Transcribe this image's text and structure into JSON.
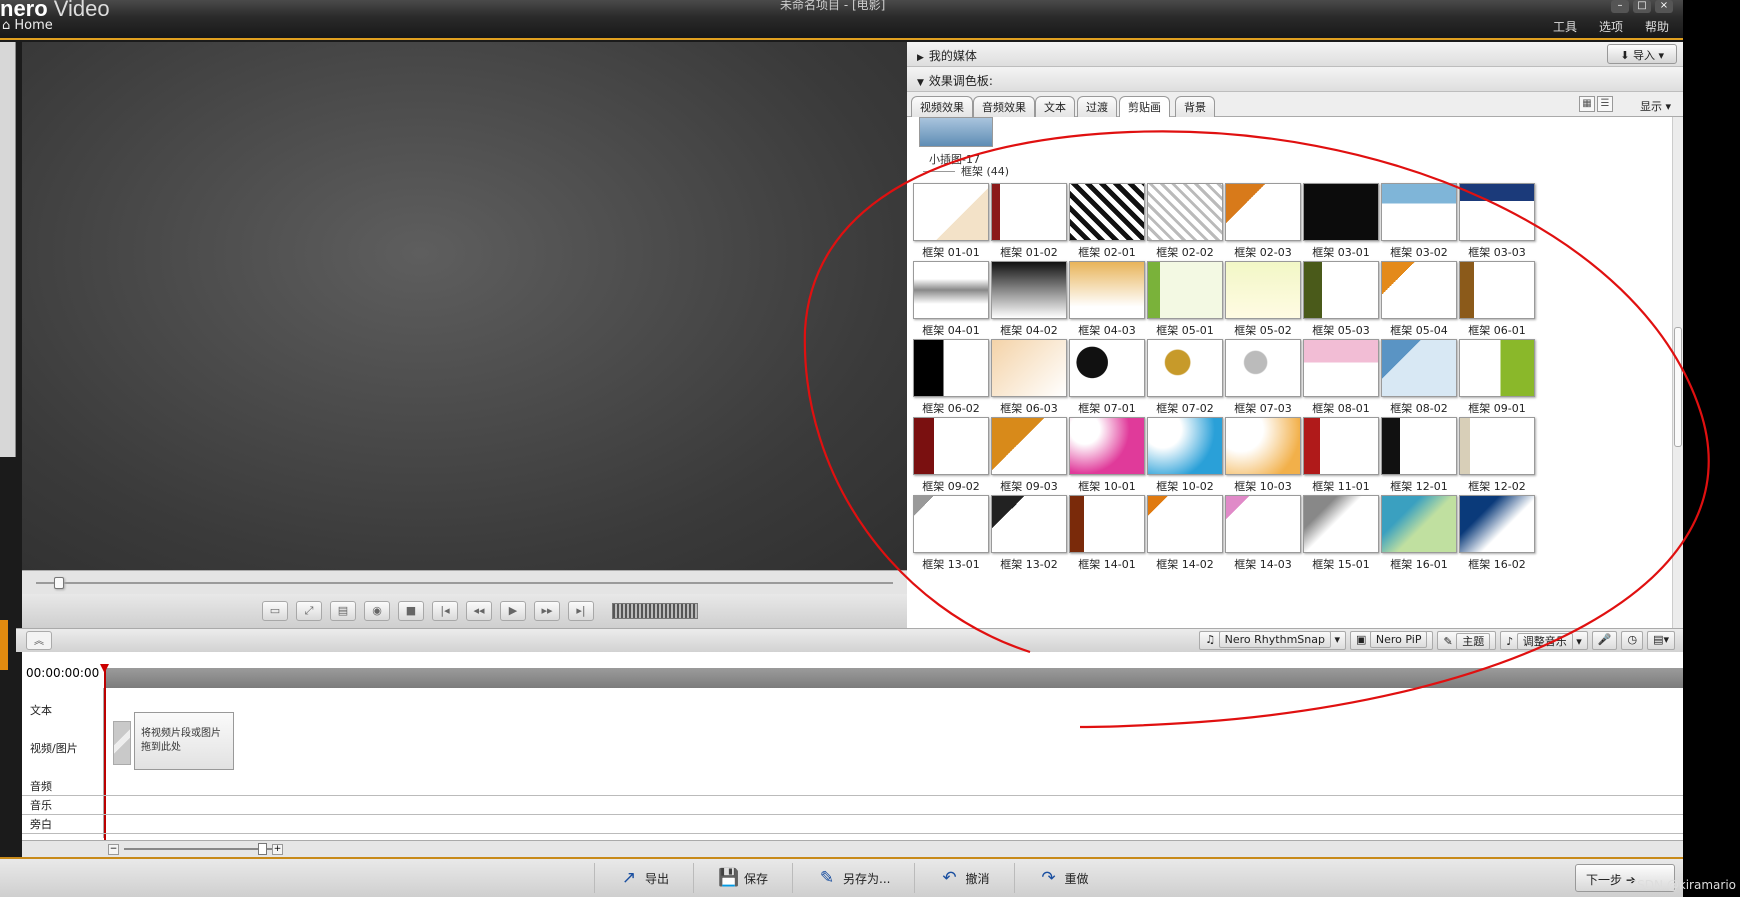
{
  "app": {
    "logo": "nero",
    "logo_suffix": "Video",
    "home": "Home",
    "window_title": "未命名项目 - [电影]",
    "menus": [
      "工具",
      "选项",
      "帮助"
    ]
  },
  "panels": {
    "my_media": "我的媒体",
    "import": "导入",
    "effects_palette": "效果调色板:",
    "show": "显示"
  },
  "tabs": [
    "视频效果",
    "音频效果",
    "文本",
    "过渡",
    "剪贴画",
    "背景"
  ],
  "active_tab": 4,
  "prev_group_item": "小插图-17",
  "group": {
    "label": "框架 (44)"
  },
  "tiles": [
    {
      "label": "框架 01-01"
    },
    {
      "label": "框架 01-02"
    },
    {
      "label": "框架 02-01"
    },
    {
      "label": "框架 02-02"
    },
    {
      "label": "框架 02-03"
    },
    {
      "label": "框架 03-01"
    },
    {
      "label": "框架 03-02"
    },
    {
      "label": "框架 03-03"
    },
    {
      "label": "框架 04-01"
    },
    {
      "label": "框架 04-02"
    },
    {
      "label": "框架 04-03"
    },
    {
      "label": "框架 05-01"
    },
    {
      "label": "框架 05-02"
    },
    {
      "label": "框架 05-03"
    },
    {
      "label": "框架 05-04"
    },
    {
      "label": "框架 06-01"
    },
    {
      "label": "框架 06-02"
    },
    {
      "label": "框架 06-03"
    },
    {
      "label": "框架 07-01"
    },
    {
      "label": "框架 07-02"
    },
    {
      "label": "框架 07-03"
    },
    {
      "label": "框架 08-01"
    },
    {
      "label": "框架 08-02"
    },
    {
      "label": "框架 09-01"
    },
    {
      "label": "框架 09-02"
    },
    {
      "label": "框架 09-03"
    },
    {
      "label": "框架 10-01"
    },
    {
      "label": "框架 10-02"
    },
    {
      "label": "框架 10-03"
    },
    {
      "label": "框架 11-01"
    },
    {
      "label": "框架 12-01"
    },
    {
      "label": "框架 12-02"
    },
    {
      "label": "框架 13-01"
    },
    {
      "label": "框架 13-02"
    },
    {
      "label": "框架 14-01"
    },
    {
      "label": "框架 14-02"
    },
    {
      "label": "框架 14-03"
    },
    {
      "label": "框架 15-01"
    },
    {
      "label": "框架 16-01"
    },
    {
      "label": "框架 16-02"
    }
  ],
  "timeline_tools": [
    "Nero RhythmSnap",
    "Nero PiP",
    "主题",
    "调整音乐"
  ],
  "timeline": {
    "timecode": "00:00:00:00",
    "tracks": [
      "文本",
      "视频/图片",
      "音频",
      "音乐",
      "旁白"
    ],
    "drop_hint": "将视频片段或图片\n拖到此处"
  },
  "footer": {
    "buttons": [
      "导出",
      "保存",
      "另存为...",
      "撤消",
      "重做"
    ],
    "next": "下一步"
  },
  "watermark": "CSDN @kiramario",
  "colors": {
    "accent": "#e0a020",
    "annotation": "#e01010"
  }
}
